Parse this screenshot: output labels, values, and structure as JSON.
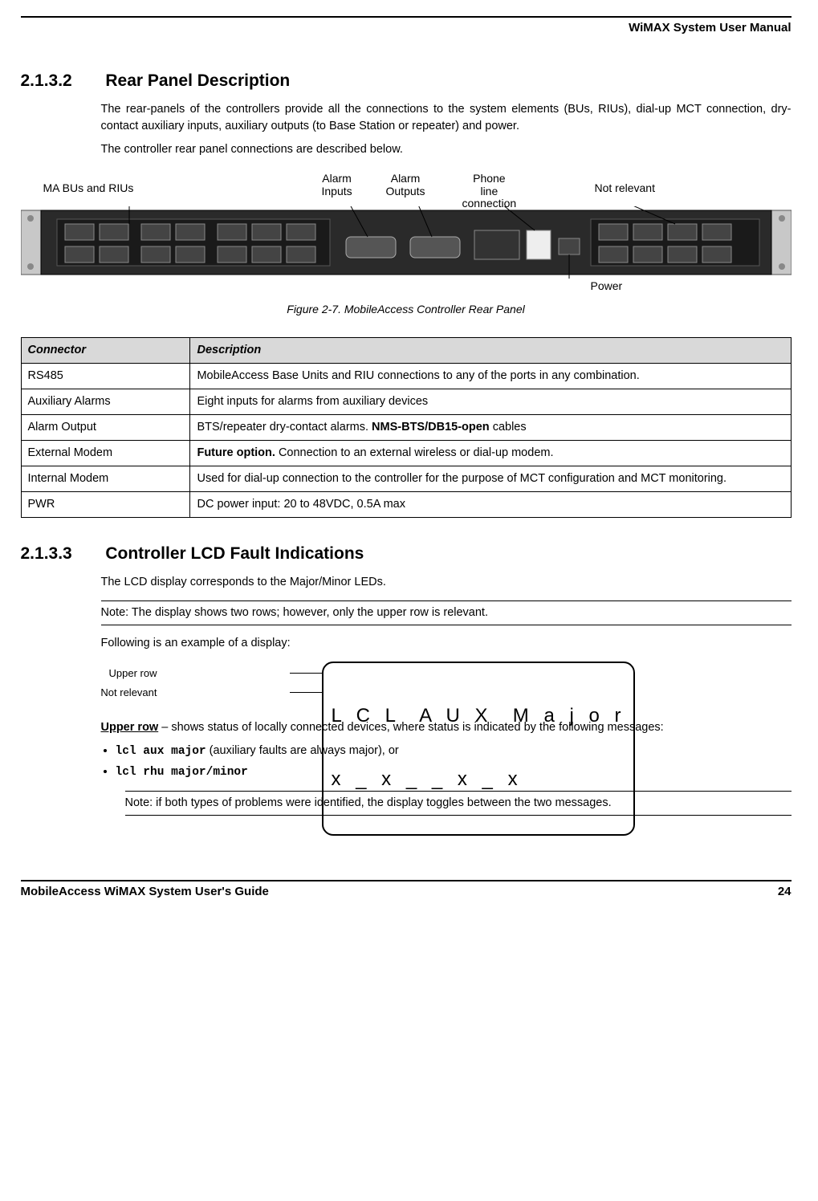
{
  "header_title": "WiMAX System User Manual",
  "footer_left": "MobileAccess WiMAX System User's Guide",
  "footer_right": "24",
  "s1": {
    "num": "2.1.3.2",
    "title": "Rear Panel Description",
    "p1": "The rear-panels of the controllers provide all the connections to the system elements (BUs, RIUs), dial-up MCT connection, dry-contact auxiliary inputs, auxiliary outputs (to Base Station or repeater) and power.",
    "p2": "The controller rear panel connections are described below."
  },
  "annotations": {
    "a1": "MA BUs and RIUs",
    "a2": "Alarm Inputs",
    "a3": "Alarm Outputs",
    "a4": "Phone line connection",
    "a5": "Not relevant",
    "a6": "Power"
  },
  "figure_caption": "Figure 2-7. MobileAccess Controller Rear Panel",
  "table": {
    "h1": "Connector",
    "h2": "Description",
    "rows": [
      {
        "c1": "RS485",
        "c2": "MobileAccess Base Units and RIU connections to any of the ports in any combination."
      },
      {
        "c1": "Auxiliary Alarms",
        "c2": "Eight inputs for alarms from auxiliary devices"
      },
      {
        "c1": "Alarm Output",
        "c2_pre": "BTS/repeater dry-contact alarms. ",
        "c2_bold": "NMS-BTS/DB15-open",
        "c2_post": " cables"
      },
      {
        "c1": "External Modem",
        "c2_bold": "Future option.",
        "c2_post": " Connection to an external wireless or dial-up modem."
      },
      {
        "c1": "Internal Modem",
        "c2": "Used for dial-up connection to the controller for  the purpose of MCT configuration and MCT monitoring."
      },
      {
        "c1": "PWR",
        "c2": "DC power input: 20 to 48VDC, 0.5A max"
      }
    ]
  },
  "s2": {
    "num": "2.1.3.3",
    "title": "Controller LCD Fault Indications",
    "p1": "The LCD display corresponds to the Major/Minor LEDs.",
    "note1": "Note: The display shows two rows; however, only the upper row is relevant.",
    "p2": "Following is an example of a display:",
    "lcd_label_upper": "Upper row",
    "lcd_label_lower": "Not relevant",
    "lcd_row1": "L C L  A U X  M a j o r",
    "lcd_row2": "x _ x _ _ x _ x",
    "upper_row_lead": "Upper row",
    "p3": " – shows status of locally connected devices, where status is indicated by the following messages:",
    "b1_code": "lcl aux major",
    "b1_rest": " (auxiliary faults are always major), or",
    "b2_code": "lcl rhu major/minor",
    "note2": "Note: if both types of problems were identified, the display toggles between the two messages."
  }
}
